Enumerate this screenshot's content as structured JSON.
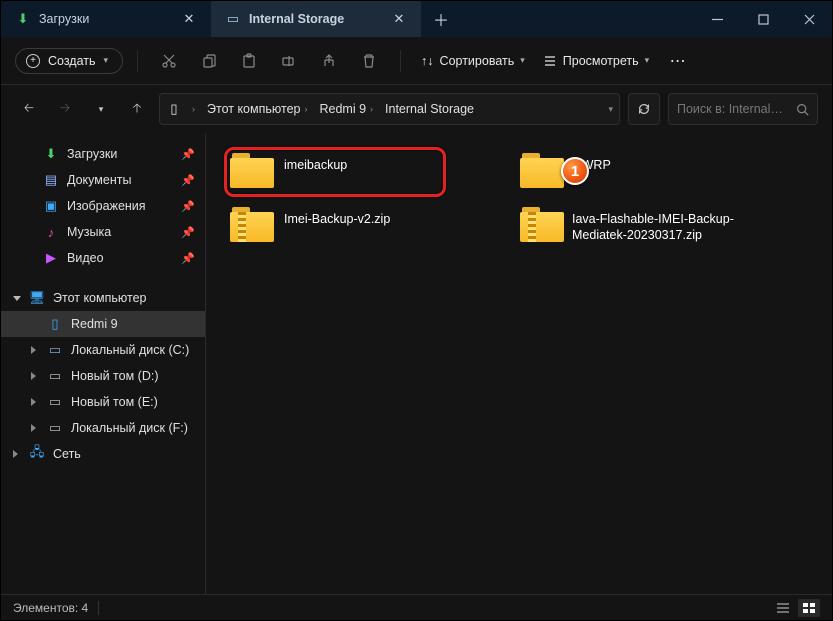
{
  "tabs": [
    {
      "icon": "download",
      "label": "Загрузки",
      "active": false
    },
    {
      "icon": "device",
      "label": "Internal Storage",
      "active": true
    }
  ],
  "toolbar": {
    "create_label": "Создать",
    "sort_label": "Сортировать",
    "view_label": "Просмотреть"
  },
  "breadcrumbs": [
    "Этот компьютер",
    "Redmi 9",
    "Internal Storage"
  ],
  "search_placeholder": "Поиск в: Internal…",
  "sidebar": {
    "quick": [
      {
        "label": "Загрузки",
        "icon": "download"
      },
      {
        "label": "Документы",
        "icon": "doc"
      },
      {
        "label": "Изображения",
        "icon": "pic"
      },
      {
        "label": "Музыка",
        "icon": "music"
      },
      {
        "label": "Видео",
        "icon": "video"
      }
    ],
    "pc_label": "Этот компьютер",
    "device": {
      "label": "Redmi 9"
    },
    "drives": [
      {
        "label": "Локальный диск (C:)"
      },
      {
        "label": "Новый том (D:)"
      },
      {
        "label": "Новый том (E:)"
      },
      {
        "label": "Локальный диск (F:)"
      }
    ],
    "network_label": "Сеть"
  },
  "items": [
    {
      "type": "folder",
      "label": "imeibackup"
    },
    {
      "type": "folder",
      "label": "TWRP"
    },
    {
      "type": "zip",
      "label": "Imei-Backup-v2.zip"
    },
    {
      "type": "zip",
      "label": "Iava-Flashable-IMEI-Backup-Mediatek-20230317.zip"
    }
  ],
  "status": {
    "count_label": "Элементов: 4"
  },
  "annotation": {
    "marker": "1"
  }
}
